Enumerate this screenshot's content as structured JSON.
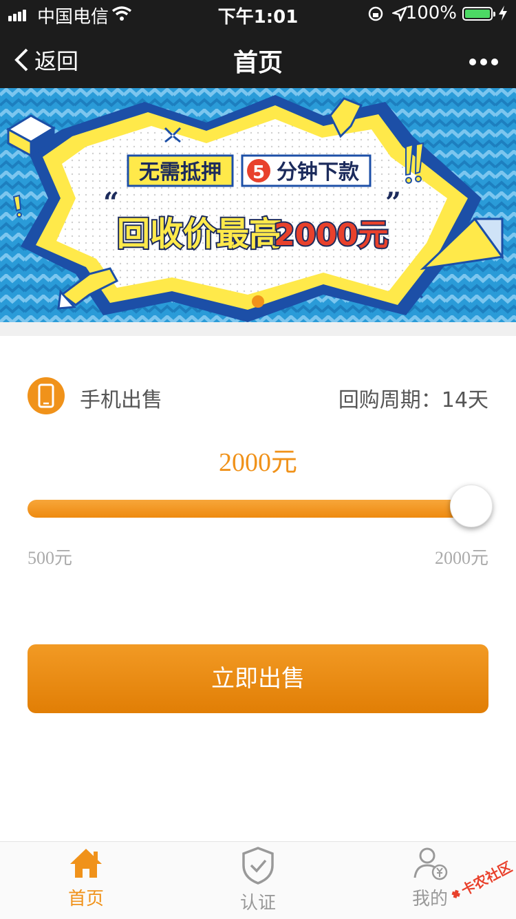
{
  "status_bar": {
    "carrier": "中国电信",
    "time": "下午1:01",
    "battery": "100%"
  },
  "nav": {
    "back_label": "返回",
    "title": "首页"
  },
  "banner": {
    "line1_a": "无需抵押",
    "line1_b_num": "5",
    "line1_b": "分钟下款",
    "line2": "回收价最高",
    "line2_amount": "2000元"
  },
  "product": {
    "name": "手机出售",
    "cycle": "回购周期：14天"
  },
  "slider": {
    "value_label": "2000元",
    "value": 2000,
    "min": 500,
    "max": 2000,
    "min_label": "500元",
    "max_label": "2000元"
  },
  "actions": {
    "sell_label": "立即出售"
  },
  "tabs": [
    {
      "label": "首页",
      "icon": "home-icon",
      "active": true
    },
    {
      "label": "认证",
      "icon": "shield-check-icon",
      "active": false
    },
    {
      "label": "我的",
      "icon": "user-yen-icon",
      "active": false
    }
  ],
  "watermark": "卡农社区",
  "colors": {
    "accent": "#f0921a",
    "navbar": "#1c1c1c",
    "banner_blue": "#2a9bd8",
    "banner_yellow": "#ffe94a"
  }
}
